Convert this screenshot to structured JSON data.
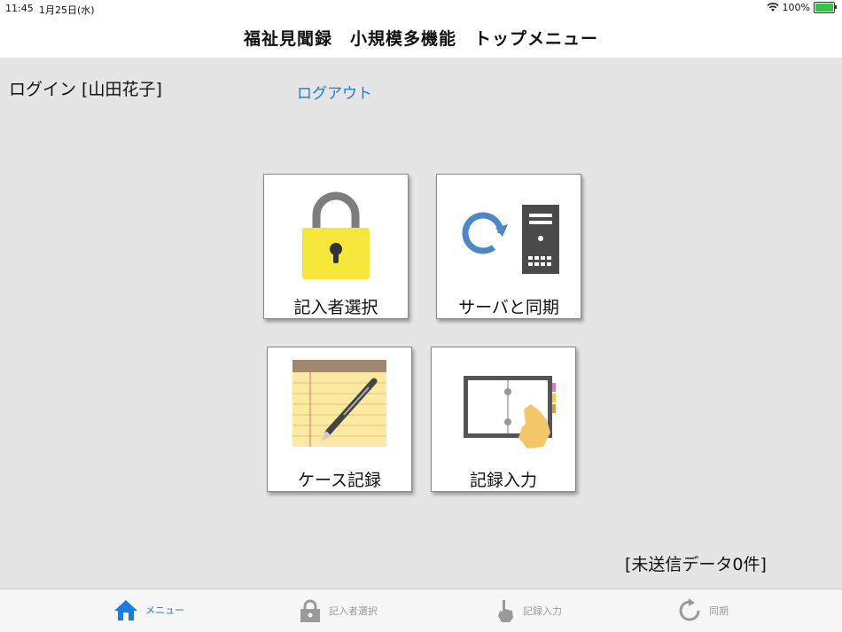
{
  "status_bar": {
    "time": "11:45",
    "date": "1月25日(水)",
    "battery": "100%"
  },
  "nav": {
    "title": "福祉見聞録　小規模多機能　トップメニュー"
  },
  "login": {
    "text": "ログイン [山田花子]",
    "logout_label": "ログアウト"
  },
  "tiles": [
    {
      "label": "記入者選択",
      "icon": "lock-icon"
    },
    {
      "label": "サーバと同期",
      "icon": "server-sync-icon"
    },
    {
      "label": "ケース記録",
      "icon": "notepad-pen-icon"
    },
    {
      "label": "記録入力",
      "icon": "binder-hand-icon"
    }
  ],
  "unsent": "[未送信データ0件]",
  "tabbar": {
    "items": [
      {
        "label": "メニュー",
        "icon": "home-icon",
        "active": true
      },
      {
        "label": "記入者選択",
        "icon": "lock-icon",
        "active": false
      },
      {
        "label": "記録入力",
        "icon": "hand-icon",
        "active": false
      },
      {
        "label": "同期",
        "icon": "sync-icon",
        "active": false
      }
    ]
  },
  "colors": {
    "accent": "#1a7be0",
    "background": "#e5e5e5",
    "lock_yellow": "#f5e83a",
    "sync_blue": "#4f86c6"
  }
}
